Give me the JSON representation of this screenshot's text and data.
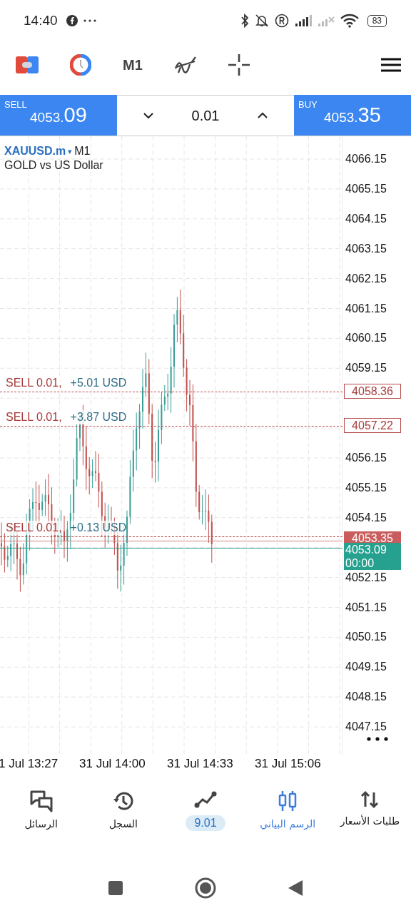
{
  "status_bar": {
    "time": "14:40",
    "battery": "83"
  },
  "toolbar": {
    "timeframe": "M1"
  },
  "trade_bar": {
    "sell": {
      "label": "SELL",
      "price_main": "4053.",
      "price_big": "09"
    },
    "volume": "0.01",
    "buy": {
      "label": "BUY",
      "price_main": "4053.",
      "price_big": "35"
    }
  },
  "chart": {
    "symbol": "XAUUSD.m",
    "symbol_caret": "▾",
    "timeframe": "M1",
    "description": "GOLD vs US Dollar",
    "price_axis": [
      "4066.15",
      "4065.15",
      "4064.15",
      "4063.15",
      "4062.15",
      "4061.15",
      "4060.15",
      "4059.15",
      "4056.15",
      "4055.15",
      "4054.15",
      "4052.15",
      "4051.15",
      "4050.15",
      "4049.15",
      "4048.15",
      "4047.15"
    ],
    "orders": [
      {
        "side": "SELL 0.01,",
        "profit": "+5.01 USD",
        "price": "4058.36"
      },
      {
        "side": "SELL 0.01,",
        "profit": "+3.87 USD",
        "price": "4057.22"
      },
      {
        "side": "SELL 0.01,",
        "profit": "+0.13 USD"
      }
    ],
    "ask": "4053.35",
    "bid": {
      "price": "4053.09",
      "timer": "00:00"
    },
    "time_axis": [
      "1 Jul 13:27",
      "31 Jul 14:00",
      "31 Jul 14:33",
      "31 Jul 15:06"
    ]
  },
  "bottom_nav": [
    {
      "label": "طلبات الأسعار",
      "kind": "text",
      "selected": false
    },
    {
      "label": "الرسم البياني",
      "kind": "text",
      "selected": true
    },
    {
      "label": "9.01",
      "kind": "pill",
      "selected": false
    },
    {
      "label": "السجل",
      "kind": "text",
      "selected": false
    },
    {
      "label": "الرسائل",
      "kind": "text",
      "selected": false
    }
  ]
}
